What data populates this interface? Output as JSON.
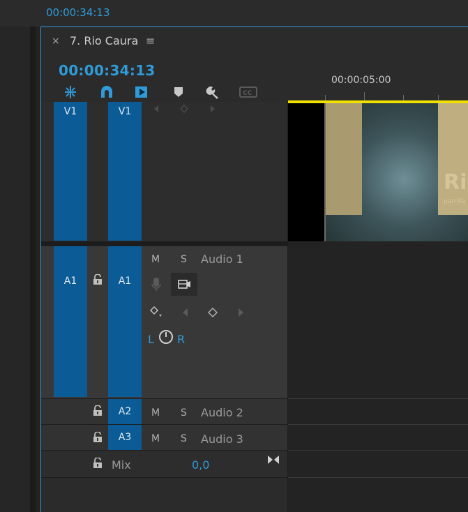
{
  "program": {
    "timecode": "00:00:34:13"
  },
  "timeline": {
    "close_label": "×",
    "sequence_title": "7. Rio Caura",
    "menu_label": "≡",
    "playhead_timecode": "00:00:34:13",
    "ruler_label": "00:00:05:00",
    "tools": [
      "snap-icon",
      "linked-selection-icon",
      "insert-icon",
      "add-marker-icon",
      "wrench-icon",
      "captions-icon"
    ]
  },
  "tracks": {
    "v1": {
      "source_label": "V1",
      "target_label": "V1"
    },
    "a1": {
      "source_label": "A1",
      "target_label": "A1",
      "mute": "M",
      "solo": "S",
      "name": "Audio 1",
      "pan_left": "L",
      "pan_right": "R"
    },
    "a2": {
      "target_label": "A2",
      "mute": "M",
      "solo": "S",
      "name": "Audio 2"
    },
    "a3": {
      "target_label": "A3",
      "mute": "M",
      "solo": "S",
      "name": "Audio 3"
    },
    "mix": {
      "name": "Mix",
      "value": "0,0"
    }
  },
  "clip": {
    "title_text": "Rio",
    "subtitle_text": "parrilla"
  },
  "colors": {
    "accent": "#2f9bd8",
    "track_target": "#0b5c96",
    "work_area": "#f0e000"
  }
}
